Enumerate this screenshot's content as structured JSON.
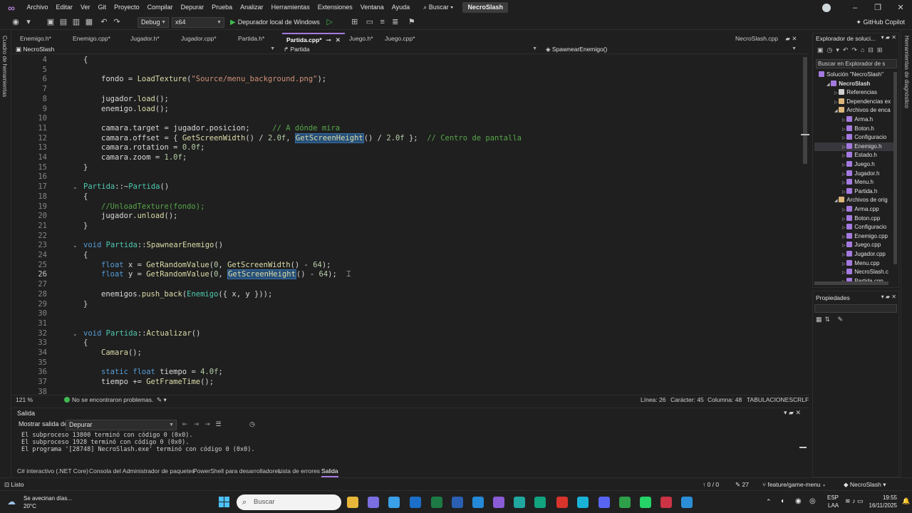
{
  "menubar": {
    "items": [
      "Archivo",
      "Editar",
      "Ver",
      "Git",
      "Proyecto",
      "Compilar",
      "Depurar",
      "Prueba",
      "Analizar",
      "Herramientas",
      "Extensiones",
      "Ventana",
      "Ayuda"
    ],
    "search_label": "Buscar",
    "solution_badge": "NecroSlash"
  },
  "toolbar": {
    "config": "Debug",
    "platform": "x64",
    "run_label": "Depurador local de Windows",
    "copilot_label": "GitHub Copilot"
  },
  "left_strip_label": "Cuadro de herramientas",
  "right_strip_label": "Herramientas de diagnóstico",
  "tabs": [
    {
      "label": "Enemigo.h*"
    },
    {
      "label": "Enemigo.cpp*"
    },
    {
      "label": "Jugador.h*"
    },
    {
      "label": "Jugador.cpp*"
    },
    {
      "label": "Partida.h*"
    },
    {
      "label": "Partida.cpp*",
      "active": true
    },
    {
      "label": "Juego.h*"
    },
    {
      "label": "Juego.cpp*"
    }
  ],
  "right_tab": "NecroSlash.cpp",
  "navbar": {
    "project": "NecroSlash",
    "scope": "Partida",
    "member": "SpawnearEnemigo()"
  },
  "code_lines": [
    {
      "n": "4",
      "t": "{"
    },
    {
      "n": "5",
      "t": ""
    },
    {
      "n": "6",
      "t": "fondo = LoadTexture(\"Source/menu_background.png\");"
    },
    {
      "n": "7",
      "t": ""
    },
    {
      "n": "8",
      "t": "jugador.load();"
    },
    {
      "n": "9",
      "t": "enemigo.load();"
    },
    {
      "n": "10",
      "t": ""
    },
    {
      "n": "11",
      "t": "camara.target = jugador.posicion;     // A dónde mira"
    },
    {
      "n": "12",
      "t": "camara.offset = { GetScreenWidth() / 2.0f, GetScreenHeight() / 2.0f };  // Centro de pantalla"
    },
    {
      "n": "13",
      "t": "camara.rotation = 0.0f;"
    },
    {
      "n": "14",
      "t": "camara.zoom = 1.0f;"
    },
    {
      "n": "15",
      "t": "}"
    },
    {
      "n": "16",
      "t": ""
    },
    {
      "n": "17",
      "t": "Partida::~Partida()"
    },
    {
      "n": "18",
      "t": "{"
    },
    {
      "n": "19",
      "t": "//UnloadTexture(fondo);"
    },
    {
      "n": "20",
      "t": "jugador.unload();"
    },
    {
      "n": "21",
      "t": "}"
    },
    {
      "n": "22",
      "t": ""
    },
    {
      "n": "23",
      "t": "void Partida::SpawnearEnemigo()"
    },
    {
      "n": "24",
      "t": "{"
    },
    {
      "n": "25",
      "t": "float x = GetRandomValue(0, GetScreenWidth() - 64);"
    },
    {
      "n": "26",
      "t": "float y = GetRandomValue(0, GetScreenHeight() - 64);"
    },
    {
      "n": "27",
      "t": ""
    },
    {
      "n": "28",
      "t": "enemigos.push_back(Enemigo({ x, y }));"
    },
    {
      "n": "29",
      "t": "}"
    },
    {
      "n": "30",
      "t": ""
    },
    {
      "n": "31",
      "t": ""
    },
    {
      "n": "32",
      "t": "void Partida::Actualizar()"
    },
    {
      "n": "33",
      "t": "{"
    },
    {
      "n": "34",
      "t": "Camara();"
    },
    {
      "n": "35",
      "t": ""
    },
    {
      "n": "36",
      "t": "static float tiempo = 4.0f;"
    },
    {
      "n": "37",
      "t": "tiempo += GetFrameTime();"
    },
    {
      "n": "38",
      "t": ""
    }
  ],
  "editor_status": {
    "zoom": "121 %",
    "problems": "No se encontraron problemas.",
    "line": "Línea: 26",
    "char": "Carácter: 45",
    "col": "Columna: 48",
    "tabs": "TABULACIONES",
    "eol": "CRLF"
  },
  "output": {
    "title": "Salida",
    "show_label": "Mostrar salida de:",
    "source": "Depurar",
    "lines": [
      "El subproceso 13800 terminó con código 0 (0x0).",
      "El subproceso 1928 terminó con código 0 (0x0).",
      "El programa '[28748] NecroSlash.exe' terminó con código 0 (0x0)."
    ]
  },
  "bottom_tabs": [
    "C# interactivo (.NET Core)",
    "Consola del Administrador de paquetes",
    "PowerShell para desarrolladores",
    "Lista de errores",
    "Salida"
  ],
  "solution_explorer": {
    "title": "Explorador de soluci...",
    "search": "Buscar en Explorador de s",
    "items": [
      {
        "label": "Solución \"NecroSlash\"",
        "indent": 0,
        "icon": "solution"
      },
      {
        "label": "NecroSlash",
        "indent": 1,
        "icon": "project",
        "bold": true
      },
      {
        "label": "Referencias",
        "indent": 2,
        "icon": "refs"
      },
      {
        "label": "Dependencias ex",
        "indent": 2,
        "icon": "folder"
      },
      {
        "label": "Archivos de enca",
        "indent": 2,
        "icon": "folder"
      },
      {
        "label": "Arma.h",
        "indent": 3,
        "icon": "header"
      },
      {
        "label": "Boton.h",
        "indent": 3,
        "icon": "header"
      },
      {
        "label": "Configuracio",
        "indent": 3,
        "icon": "header"
      },
      {
        "label": "Enemigo.h",
        "indent": 3,
        "icon": "header",
        "selected": true
      },
      {
        "label": "Estado.h",
        "indent": 3,
        "icon": "header"
      },
      {
        "label": "Juego.h",
        "indent": 3,
        "icon": "header"
      },
      {
        "label": "Jugador.h",
        "indent": 3,
        "icon": "header"
      },
      {
        "label": "Menu.h",
        "indent": 3,
        "icon": "header"
      },
      {
        "label": "Partida.h",
        "indent": 3,
        "icon": "header"
      },
      {
        "label": "Archivos de orig",
        "indent": 2,
        "icon": "folder"
      },
      {
        "label": "Arma.cpp",
        "indent": 3,
        "icon": "cpp"
      },
      {
        "label": "Boton.cpp",
        "indent": 3,
        "icon": "cpp"
      },
      {
        "label": "Configuracio",
        "indent": 3,
        "icon": "cpp"
      },
      {
        "label": "Enemigo.cpp",
        "indent": 3,
        "icon": "cpp"
      },
      {
        "label": "Juego.cpp",
        "indent": 3,
        "icon": "cpp"
      },
      {
        "label": "Jugador.cpp",
        "indent": 3,
        "icon": "cpp"
      },
      {
        "label": "Menu.cpp",
        "indent": 3,
        "icon": "cpp"
      },
      {
        "label": "NecroSlash.c",
        "indent": 3,
        "icon": "cpp"
      },
      {
        "label": "Partida.cpp",
        "indent": 3,
        "icon": "cpp"
      }
    ]
  },
  "properties": {
    "title": "Propiedades"
  },
  "statusbar": {
    "ready": "Listo",
    "changes": "0 / 0",
    "commits": "27",
    "branch": "feature/game-menu",
    "repo": "NecroSlash"
  },
  "taskbar": {
    "weather_text": "Se avecinan días...",
    "temperature": "20°C",
    "search_placeholder": "Buscar",
    "lang": "ESP",
    "lang2": "LAA",
    "time": "19:55",
    "date": "16/11/2025"
  },
  "colors": {
    "accent": "#a57ae0",
    "keyword": "#569cd6",
    "type": "#4ec9b0",
    "function": "#dcdcaa",
    "comment": "#57a64a",
    "string": "#ce9178",
    "number": "#b5cea8"
  }
}
